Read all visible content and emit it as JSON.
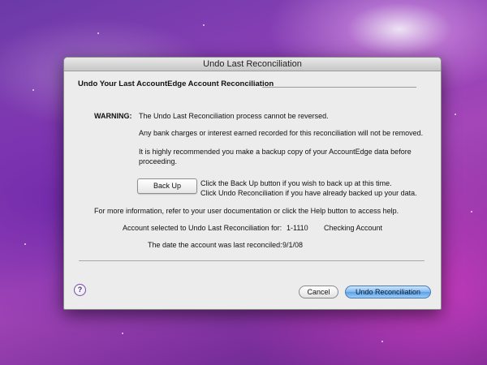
{
  "window": {
    "title": "Undo Last Reconciliation"
  },
  "section": {
    "title": "Undo Your Last AccountEdge Account Reconciliation"
  },
  "warning": {
    "label": "WARNING:",
    "line1": "The Undo Last Reconciliation process cannot be reversed.",
    "line2": "Any bank charges or interest earned recorded for this reconciliation will not be removed.",
    "line3a": "It is highly recommended you make a backup copy of your AccountEdge data before",
    "line3b": "proceeding."
  },
  "backup": {
    "button_label": "Back Up",
    "hint1": "Click the Back Up button if you wish to back up at this time.",
    "hint2": "Click Undo Reconciliation if you have already backed up your data."
  },
  "info": {
    "help_text": "For more information, refer to your user documentation or click the Help button to access help.",
    "account_label": "Account selected to Undo Last Reconciliation for:",
    "account_number": "1-1110",
    "account_name": "Checking Account",
    "last_reconciled_label": "The date the account was last reconciled:",
    "last_reconciled_date": "9/1/08"
  },
  "footer": {
    "help_label": "?",
    "cancel_label": "Cancel",
    "undo_label": "Undo Reconciliation"
  },
  "colors": {
    "default_button": "#5aa0e8",
    "dialog_background": "#ececec"
  }
}
